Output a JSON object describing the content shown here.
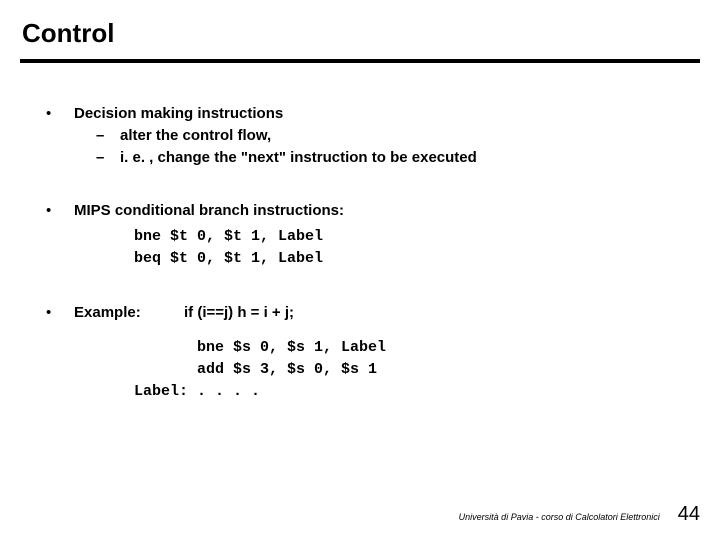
{
  "title": "Control",
  "bullets": {
    "b1": {
      "head": "Decision making instructions",
      "s1": "alter the control flow,",
      "s2": "i. e. , change the \"next\" instruction to be executed"
    },
    "b2": {
      "head": "MIPS conditional branch instructions:",
      "code": "bne $t 0, $t 1, Label\nbeq $t 0, $t 1, Label"
    },
    "b3": {
      "label": "Example:",
      "cond": "if (i==j) h = i + j;",
      "code": "       bne $s 0, $s 1, Label\n       add $s 3, $s 0, $s 1\nLabel: . . . ."
    }
  },
  "footer": {
    "text": "Università di Pavia  - corso di Calcolatori Elettronici",
    "page": "44"
  }
}
